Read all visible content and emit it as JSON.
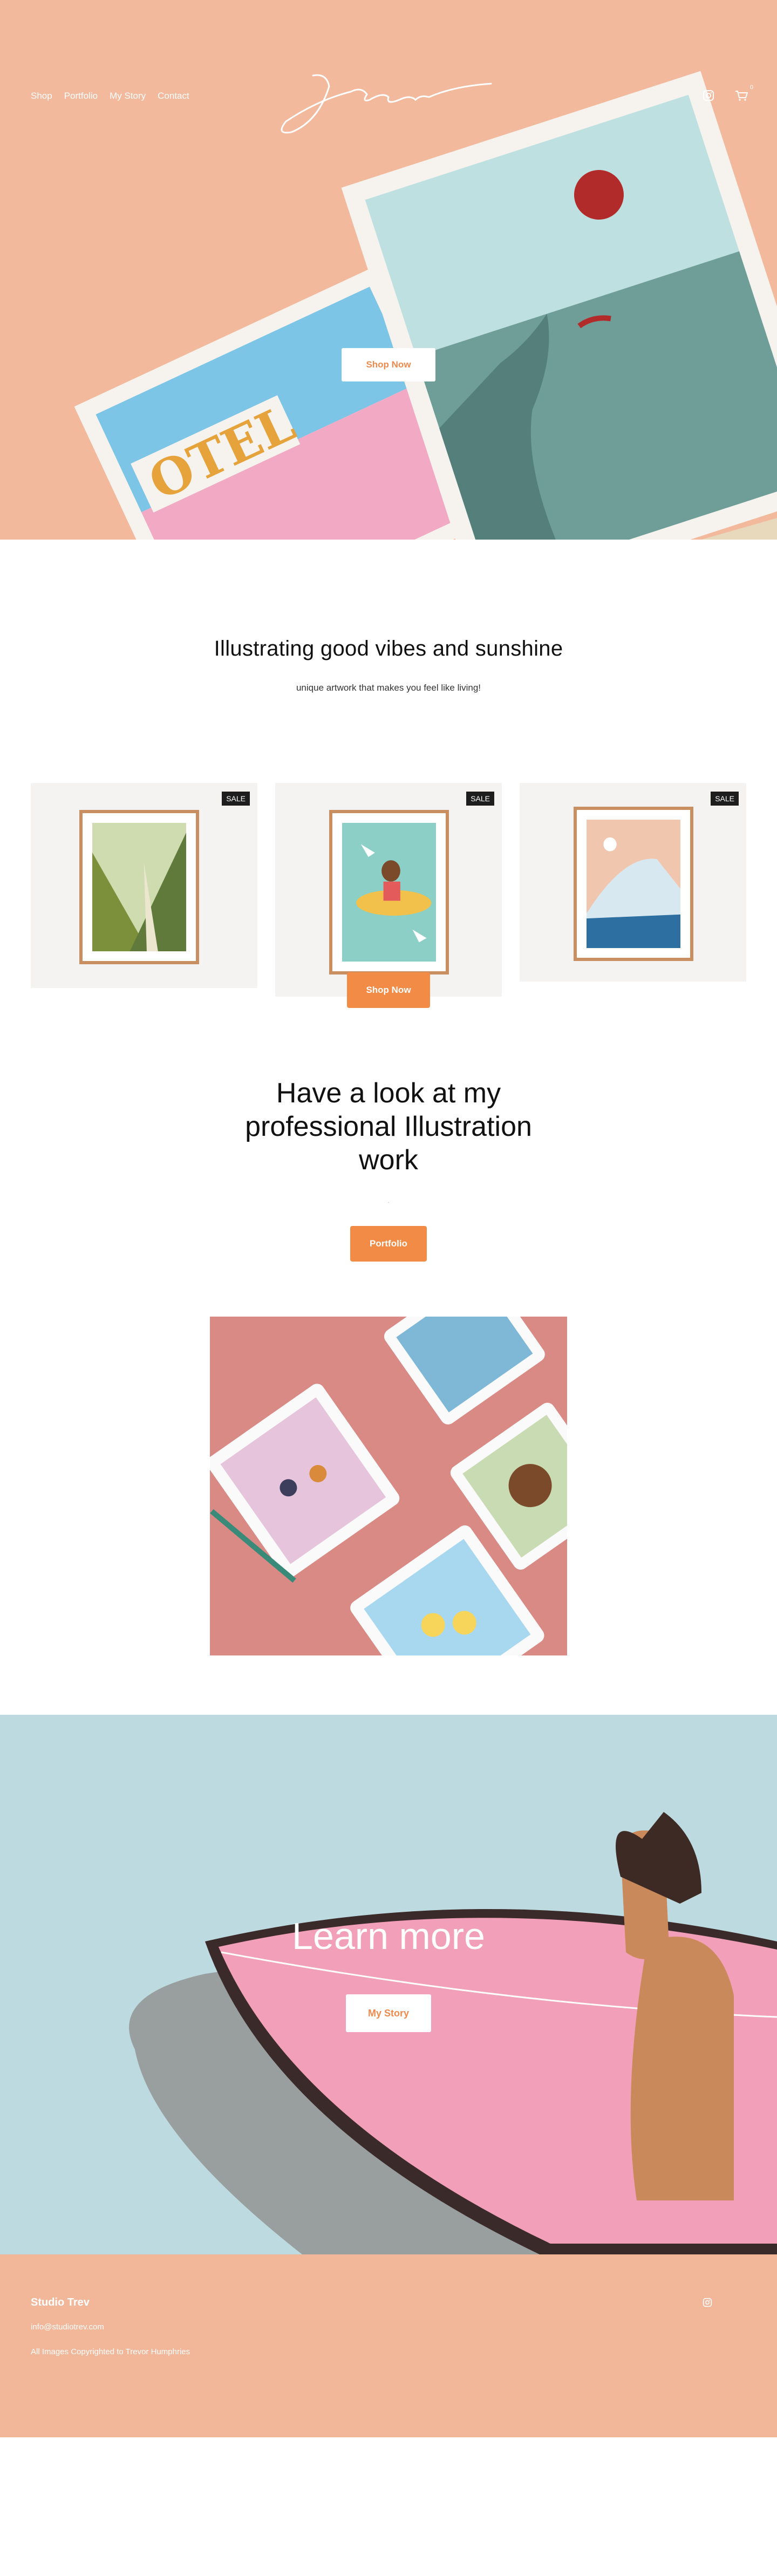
{
  "nav": {
    "links": [
      "Shop",
      "Portfolio",
      "My Story",
      "Contact"
    ]
  },
  "hero": {
    "cta": "Shop Now",
    "cart_count": "0",
    "poster_sign_text": "OTEL"
  },
  "intro": {
    "title": "Illustrating good vibes and sunshine",
    "subtitle": "unique artwork that makes you feel like living!"
  },
  "products": {
    "badge": "SALE",
    "cta": "Shop Now"
  },
  "portfolio": {
    "title_line1": "Have a look at my",
    "title_line2": "professional Illustration",
    "title_line3": "work",
    "dot": ".",
    "cta": "Portfolio"
  },
  "learn": {
    "title": "Learn more",
    "cta": "My Story"
  },
  "footer": {
    "brand": "Studio Trev",
    "email": "info@studiotrev.com",
    "copyright": "All Images Copyrighted to Trevor Humphries"
  },
  "colors": {
    "accent": "#f18b46",
    "peach": "#f2b99d",
    "sea": "#bcdadf"
  }
}
